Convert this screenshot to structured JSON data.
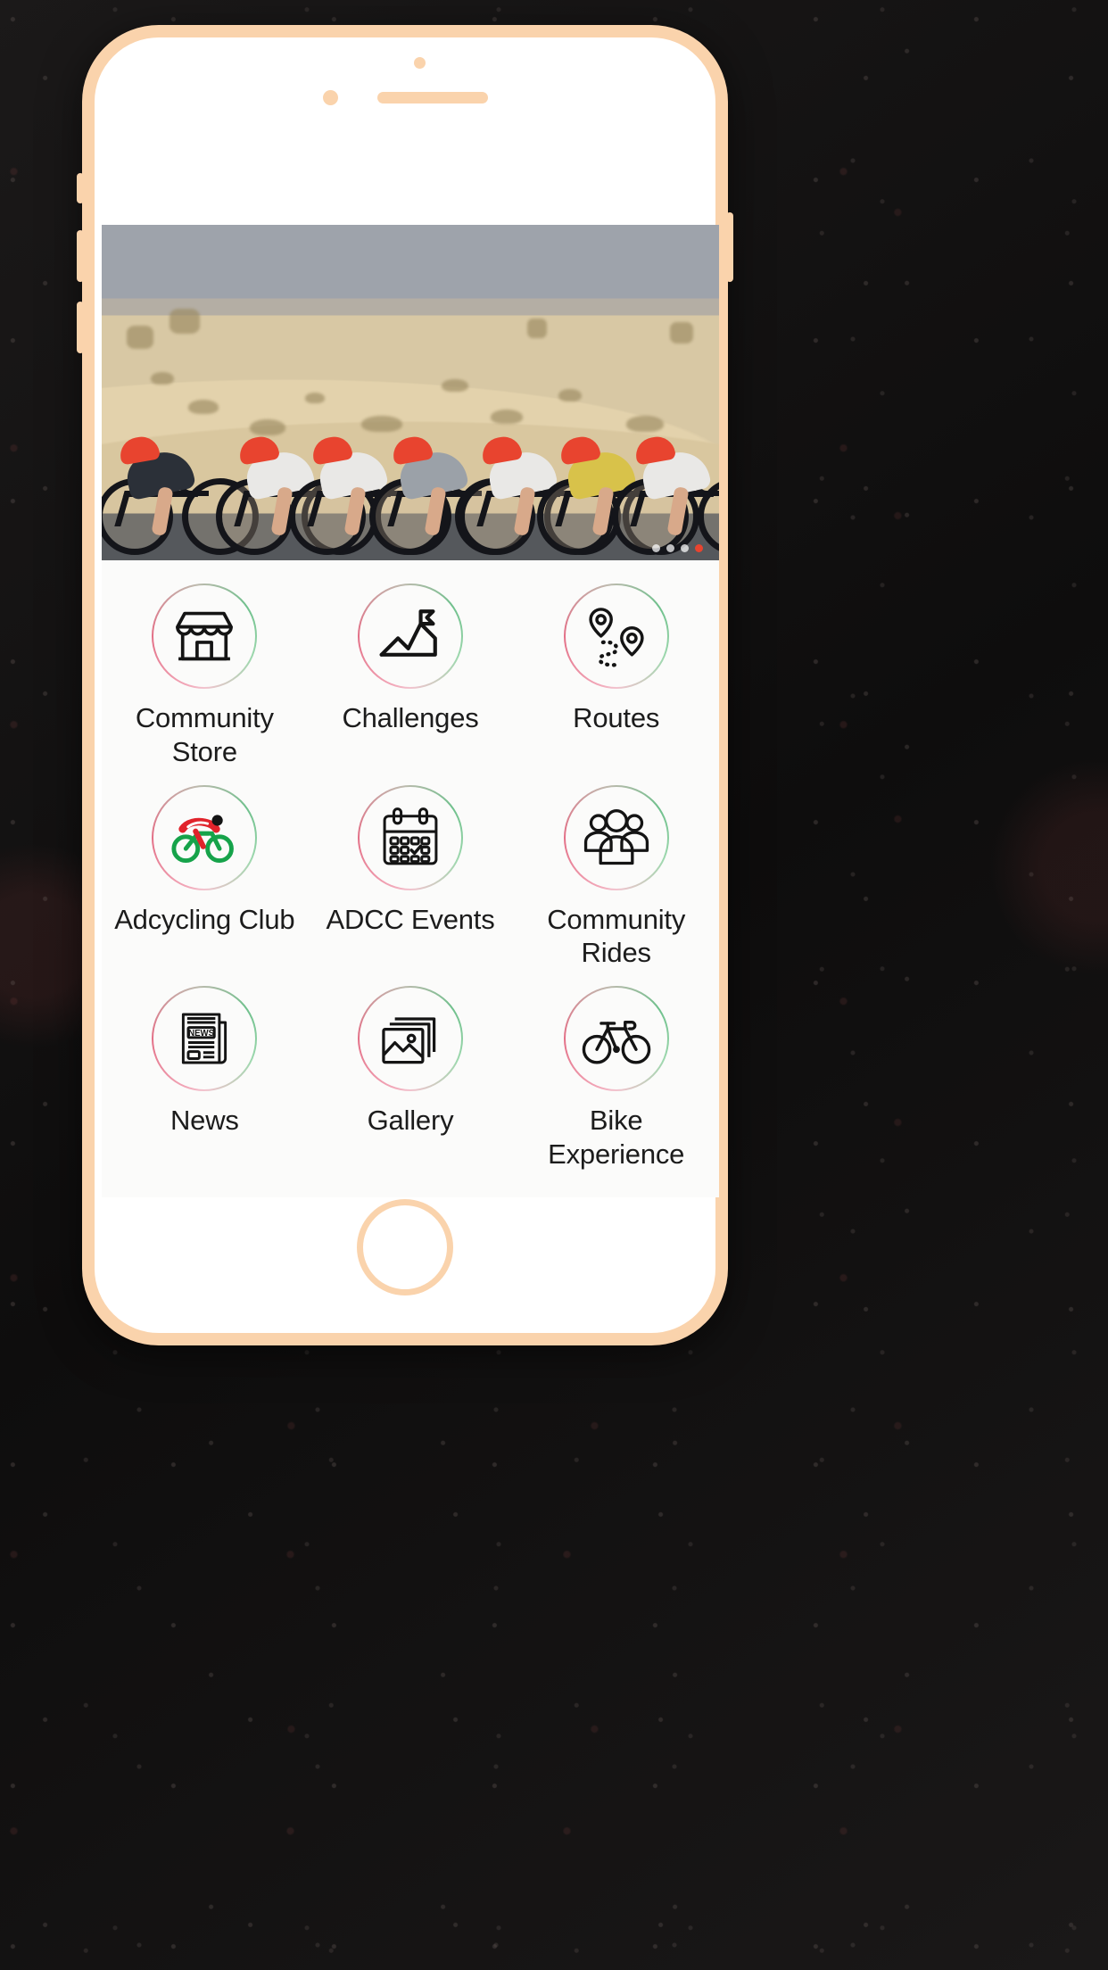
{
  "device": {
    "frame_color": "#fad3ac",
    "screen_background": "#ffffff",
    "elements": {
      "front_camera": "front-camera",
      "earpiece_speaker": "earpiece-speaker",
      "proximity_sensor": "proximity-sensor",
      "home_button": "home-button",
      "volume_up": "volume-up-button",
      "volume_down": "volume-down-button",
      "silent_switch": "silent-switch",
      "power_button": "power-button"
    }
  },
  "hero": {
    "name": "hero-carousel",
    "description": "Group of road cyclists riding in a desert dune landscape",
    "dots": [
      {
        "active": false
      },
      {
        "active": false
      },
      {
        "active": false
      },
      {
        "active": true
      }
    ]
  },
  "grid": {
    "rows": [
      [
        {
          "label": "Community Store",
          "icon": "storefront-icon"
        },
        {
          "label": "Challenges",
          "icon": "summit-flag-icon"
        },
        {
          "label": "Routes",
          "icon": "map-pins-route-icon"
        }
      ],
      [
        {
          "label": "Adcycling Club",
          "icon": "cyclist-logo-icon"
        },
        {
          "label": "ADCC Events",
          "icon": "calendar-check-icon"
        },
        {
          "label": "Community Rides",
          "icon": "people-group-icon"
        }
      ],
      [
        {
          "label": "News",
          "icon": "newspaper-icon"
        },
        {
          "label": "Gallery",
          "icon": "photo-stack-icon"
        },
        {
          "label": "Bike Experience",
          "icon": "bicycle-icon"
        }
      ]
    ]
  },
  "colors": {
    "ring_gradient_green": "#6fc08c",
    "ring_gradient_pink": "#e36f86",
    "icon_stroke": "#141414",
    "label_text": "#1c1c1c",
    "logo_red": "#e1232b",
    "logo_green": "#16a34a",
    "screen_bg": "#fbfbfa"
  },
  "news_icon_text": "NEWS"
}
